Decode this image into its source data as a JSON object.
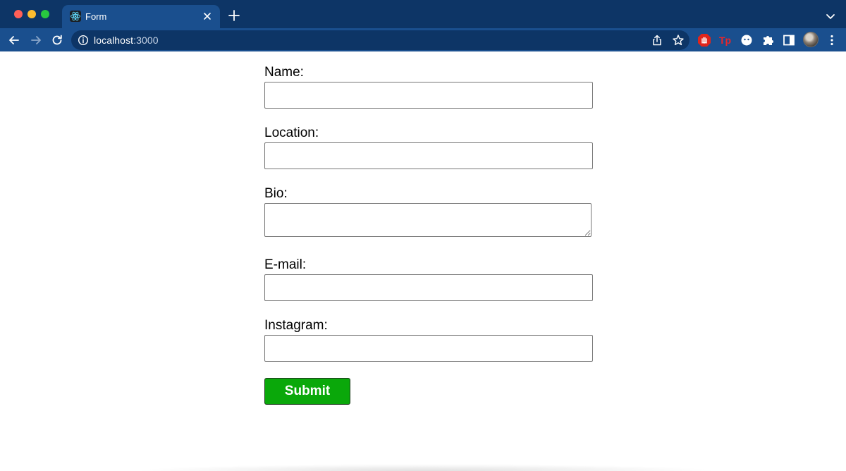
{
  "browser": {
    "tab": {
      "title": "Form",
      "favicon": "react-atom-icon"
    },
    "address_bar": {
      "host": "localhost",
      "port": ":3000"
    },
    "icons": {
      "back": "arrow-left-icon",
      "forward": "arrow-right-icon",
      "reload": "reload-icon",
      "info": "info-icon",
      "share": "share-icon",
      "bookmark": "star-icon",
      "extensions": [
        "stop-hand-extension-icon",
        "tp-extension-icon",
        "face-extension-icon",
        "puzzle-icon"
      ],
      "sidepanel": "side-panel-icon",
      "menu": "kebab-menu-icon"
    },
    "colors": {
      "chrome_dark": "#0d3566",
      "chrome_light": "#1a4f8e"
    }
  },
  "form": {
    "fields": [
      {
        "label": "Name:",
        "value": ""
      },
      {
        "label": "Location:",
        "value": ""
      },
      {
        "label": "Bio:",
        "value": ""
      },
      {
        "label": "E-mail:",
        "value": ""
      },
      {
        "label": "Instagram:",
        "value": ""
      }
    ],
    "submit_label": "Submit",
    "submit_color": "#0aa80a"
  }
}
